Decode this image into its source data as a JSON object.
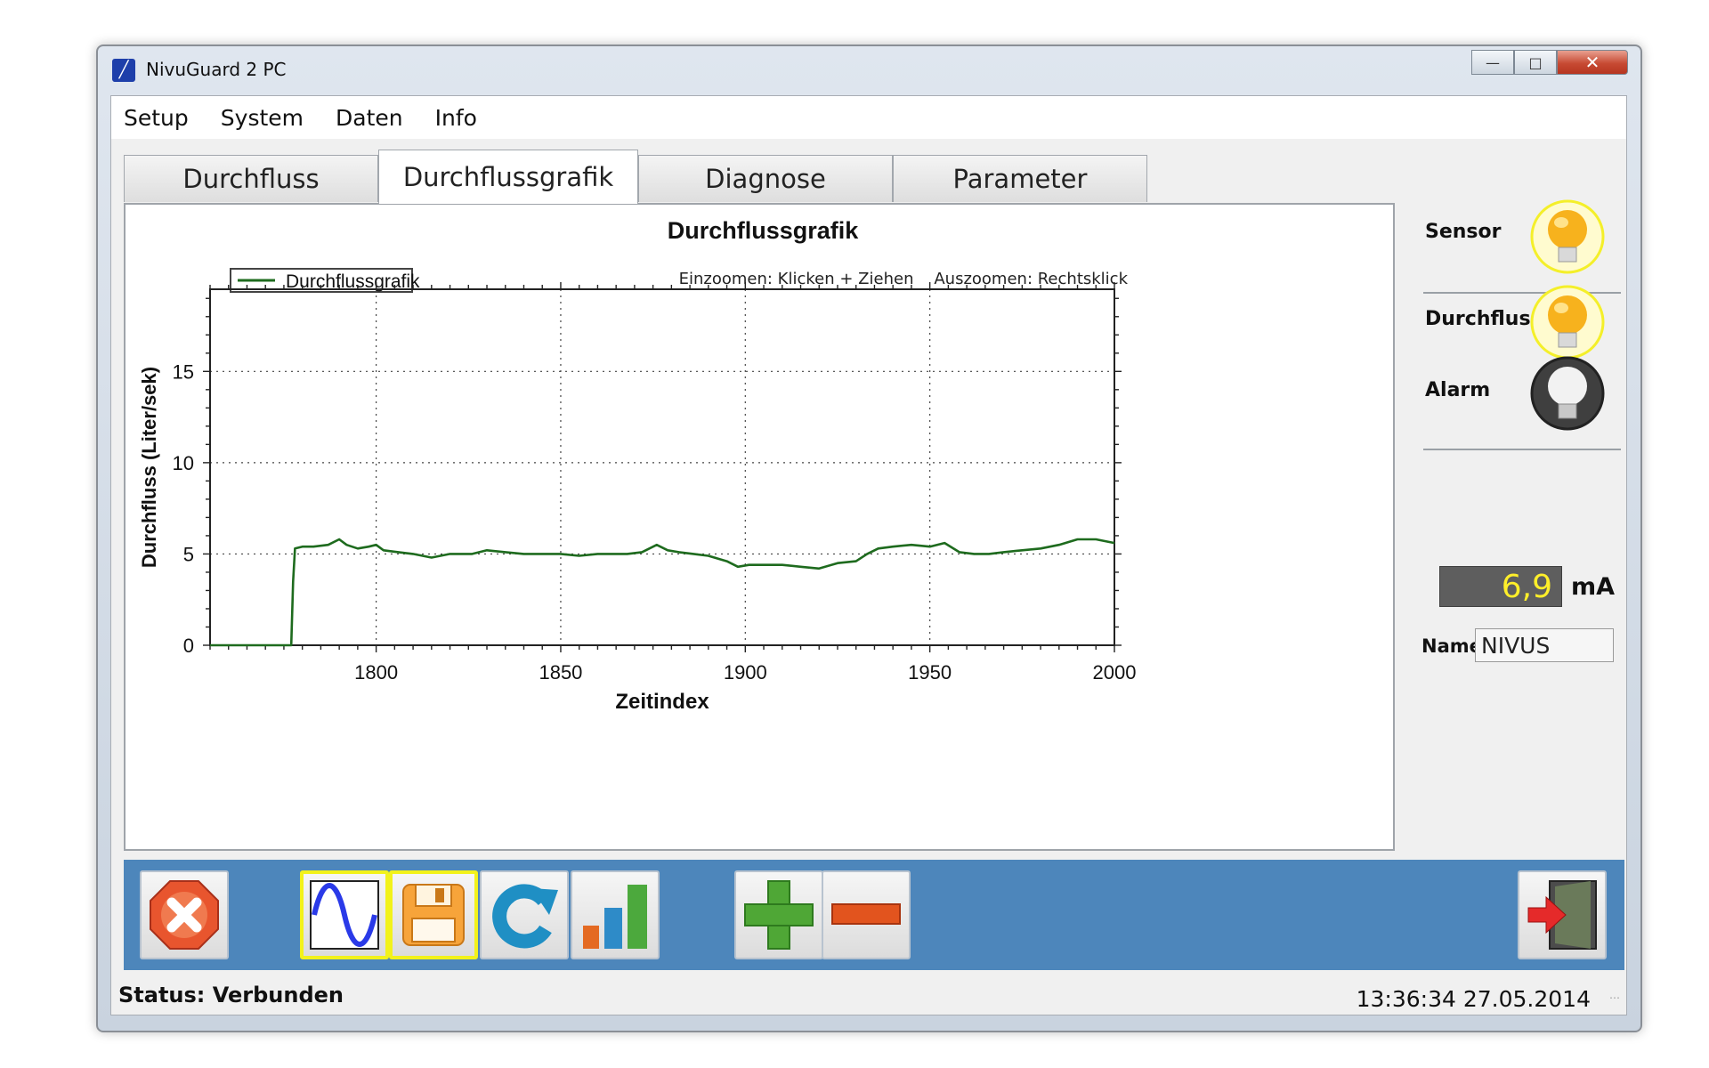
{
  "window": {
    "title": "NivuGuard 2  PC",
    "icon": "nivuguard-app-icon",
    "controls": {
      "minimize": "—",
      "maximize": "□",
      "close": "✕"
    }
  },
  "menu": {
    "items": [
      "Setup",
      "System",
      "Daten",
      "Info"
    ]
  },
  "tabs": {
    "items": [
      "Durchfluss",
      "Durchflussgrafik",
      "Diagnose",
      "Parameter"
    ],
    "active": "Durchflussgrafik"
  },
  "chart_data": {
    "type": "line",
    "title": "Durchflussgrafik",
    "xlabel": "Zeitindex",
    "ylabel": "Durchfluss (Liter/sek)",
    "hint": "Einzoomen: Klicken + Ziehen    Auszoomen: Rechtsklick",
    "xlim": [
      1755,
      2000
    ],
    "ylim": [
      0,
      19.5
    ],
    "x_ticks": [
      1800,
      1850,
      1900,
      1950,
      2000
    ],
    "y_ticks": [
      0,
      5,
      10,
      15
    ],
    "grid": true,
    "legend_position": "top-left",
    "series": [
      {
        "name": "Durchflussgrafik",
        "color": "#1e6b1e",
        "x": [
          1755,
          1777,
          1777.5,
          1778,
          1780,
          1783,
          1787,
          1790,
          1792,
          1795,
          1798,
          1800,
          1802,
          1806,
          1810,
          1815,
          1820,
          1826,
          1830,
          1835,
          1840,
          1845,
          1850,
          1855,
          1860,
          1864,
          1868,
          1872,
          1876,
          1879,
          1882,
          1886,
          1890,
          1895,
          1898,
          1901,
          1905,
          1910,
          1915,
          1920,
          1925,
          1930,
          1933,
          1936,
          1940,
          1945,
          1950,
          1954,
          1958,
          1962,
          1966,
          1970,
          1975,
          1980,
          1985,
          1990,
          1995,
          2000
        ],
        "y": [
          0,
          0,
          3.5,
          5.3,
          5.4,
          5.4,
          5.5,
          5.8,
          5.5,
          5.3,
          5.4,
          5.5,
          5.2,
          5.1,
          5.0,
          4.8,
          5.0,
          5.0,
          5.2,
          5.1,
          5.0,
          5.0,
          5.0,
          4.9,
          5.0,
          5.0,
          5.0,
          5.1,
          5.5,
          5.2,
          5.1,
          5.0,
          4.9,
          4.6,
          4.3,
          4.4,
          4.4,
          4.4,
          4.3,
          4.2,
          4.5,
          4.6,
          5.0,
          5.3,
          5.4,
          5.5,
          5.4,
          5.6,
          5.1,
          5.0,
          5.0,
          5.1,
          5.2,
          5.3,
          5.5,
          5.8,
          5.8,
          5.6
        ]
      }
    ]
  },
  "indicators": {
    "sensor": {
      "label": "Sensor",
      "state": "on",
      "color": "#f7b21d"
    },
    "flow": {
      "label": "Durchfluss",
      "state": "on",
      "color": "#f7b21d"
    },
    "alarm": {
      "label": "Alarm",
      "state": "off",
      "color": "#777777"
    }
  },
  "current": {
    "value": "6,9",
    "unit": "mA"
  },
  "name_field": {
    "label": "Name",
    "value": "NIVUS"
  },
  "toolbar": {
    "icons": [
      "stop-icon",
      "sine-wave-icon",
      "save-disk-icon",
      "refresh-icon",
      "bar-chart-icon",
      "plus-icon",
      "minus-icon",
      "exit-door-icon"
    ]
  },
  "status": {
    "text": "Status: Verbunden",
    "datetime": "13:36:34 27.05.2014"
  }
}
